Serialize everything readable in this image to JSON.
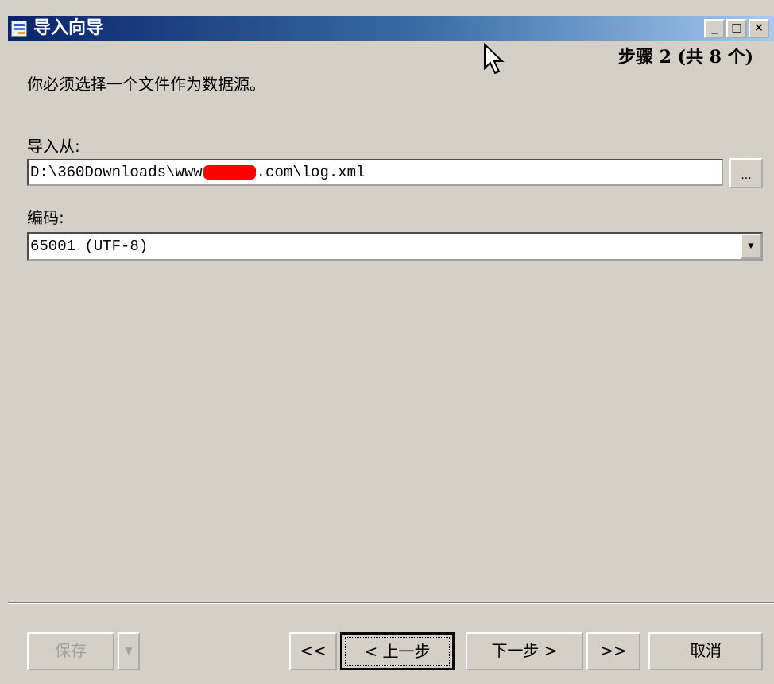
{
  "window": {
    "title": "导入向导",
    "controls": {
      "minimize": "_",
      "maximize": "□",
      "close": "×"
    }
  },
  "step_indicator": "步骤 2 (共 8 个)",
  "instruction": "你必须选择一个文件作为数据源。",
  "import_from": {
    "label": "导入从:",
    "value_prefix": "D:\\360Downloads\\www",
    "value_suffix": ".com\\log.xml",
    "browse_label": "..."
  },
  "encoding": {
    "label": "编码:",
    "selected": "65001 (UTF-8)"
  },
  "buttons": {
    "save": "保存",
    "first": "<<",
    "previous": "< 上一步",
    "next": "下一步 >",
    "last": ">>",
    "cancel": "取消"
  },
  "icons": {
    "app": "import-wizard-icon",
    "cursor": "mouse-pointer-icon",
    "dropdown": "chevron-down-icon"
  }
}
